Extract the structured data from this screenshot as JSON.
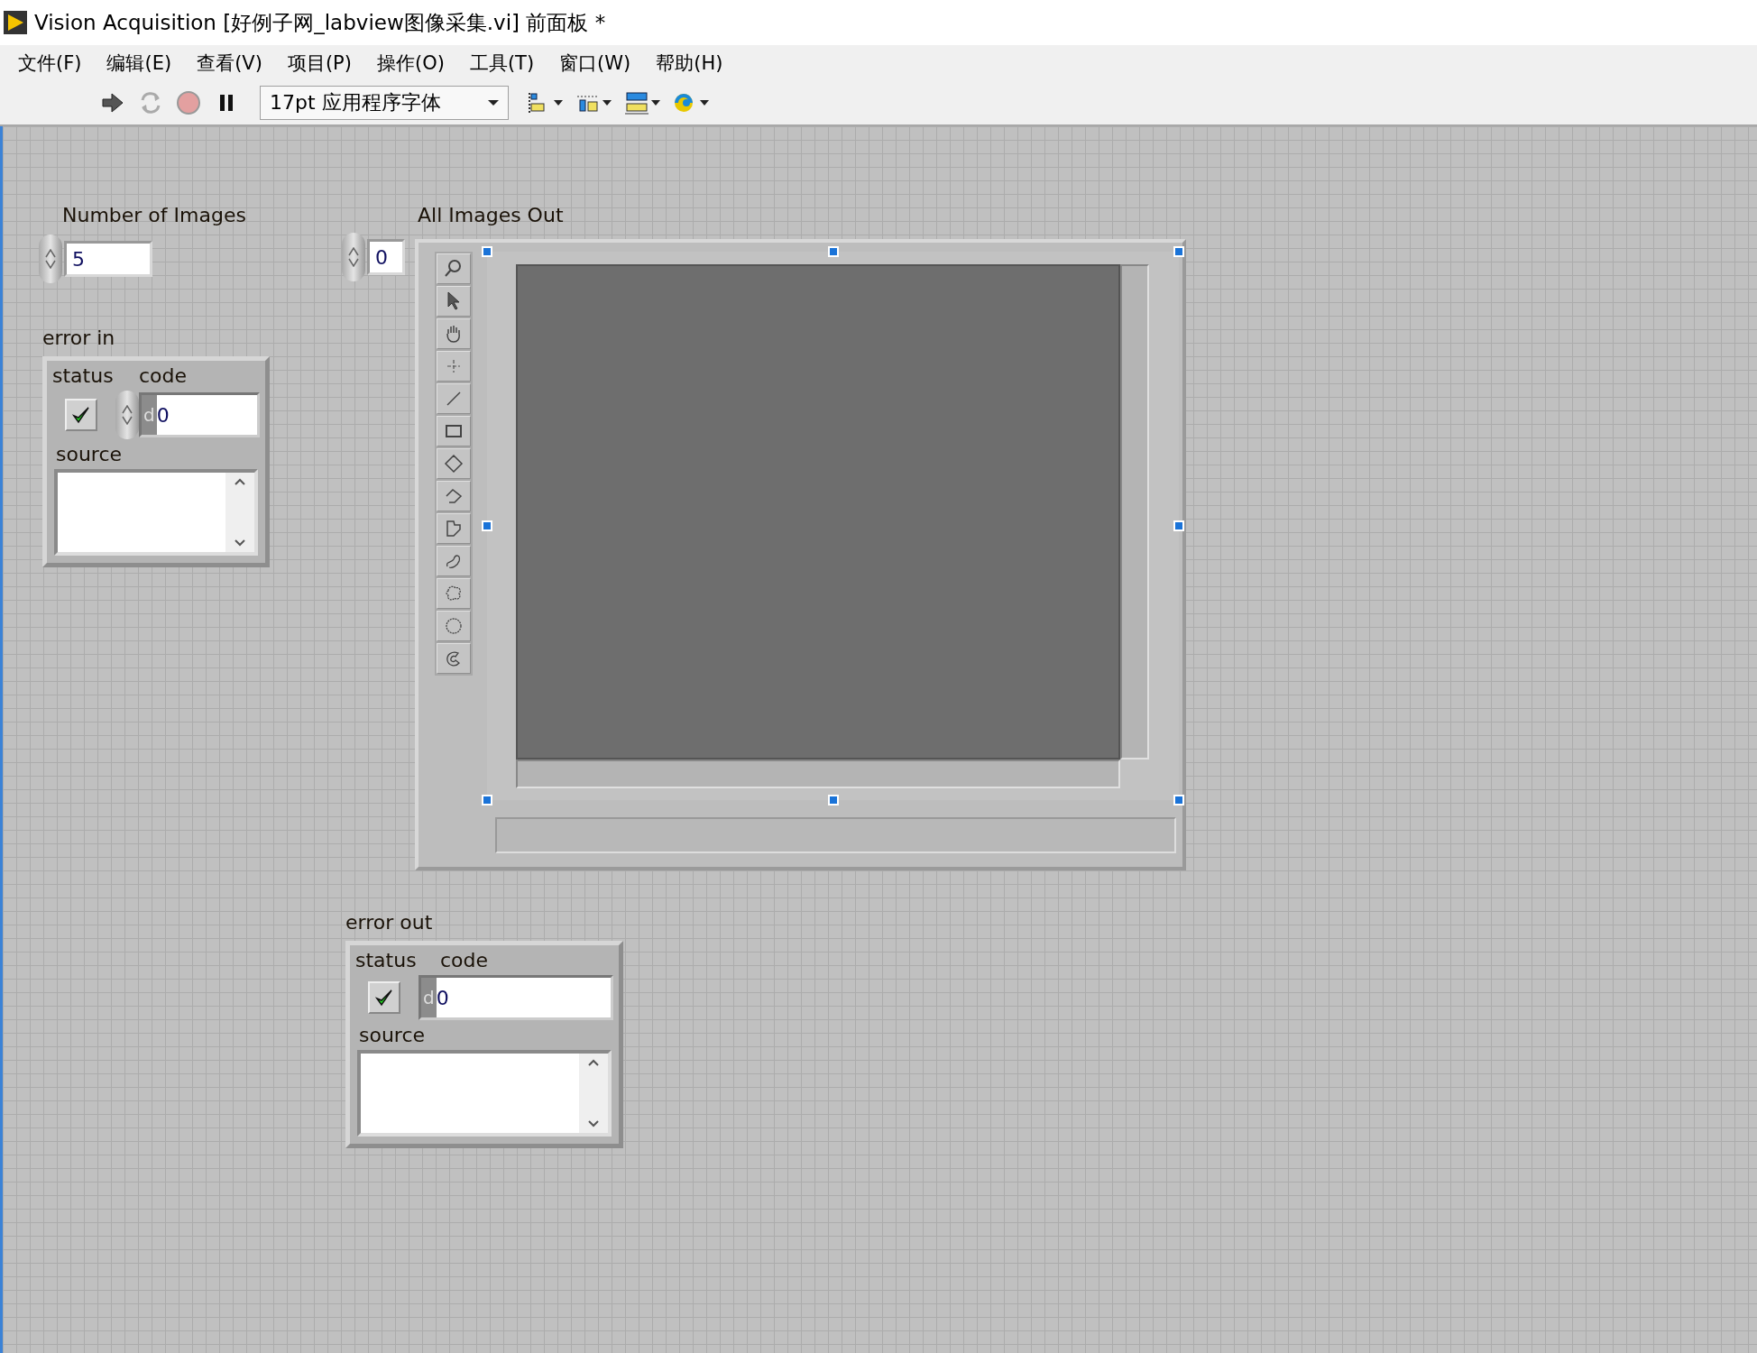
{
  "window": {
    "title": "Vision Acquisition [好例子网_labview图像采集.vi] 前面板 *"
  },
  "menu": [
    "文件(F)",
    "编辑(E)",
    "查看(V)",
    "项目(P)",
    "操作(O)",
    "工具(T)",
    "窗口(W)",
    "帮助(H)"
  ],
  "toolbar": {
    "font": "17pt 应用程序字体"
  },
  "number_of_images": {
    "label": "Number of Images",
    "value": "5"
  },
  "all_images_out": {
    "label": "All Images Out",
    "index": "0",
    "selected": true,
    "tools": [
      {
        "kind": "zoom"
      },
      {
        "kind": "pointer"
      },
      {
        "kind": "pan"
      },
      {
        "kind": "point"
      },
      {
        "kind": "line"
      },
      {
        "kind": "rectangle"
      },
      {
        "kind": "rotated-rectangle"
      },
      {
        "kind": "polyline"
      },
      {
        "kind": "polygon"
      },
      {
        "kind": "freehand-line"
      },
      {
        "kind": "freehand"
      },
      {
        "kind": "oval"
      },
      {
        "kind": "annulus"
      }
    ]
  },
  "error_clusters": [
    {
      "kind": "control",
      "label": "error in",
      "status_label": "status",
      "status_ok": true,
      "code_label": "code",
      "radix": "d",
      "code": "0",
      "source_label": "source"
    },
    {
      "kind": "indicator",
      "label": "error out",
      "status_label": "status",
      "status_ok": true,
      "code_label": "code",
      "radix": "d",
      "code": "0",
      "source_label": "source"
    }
  ]
}
